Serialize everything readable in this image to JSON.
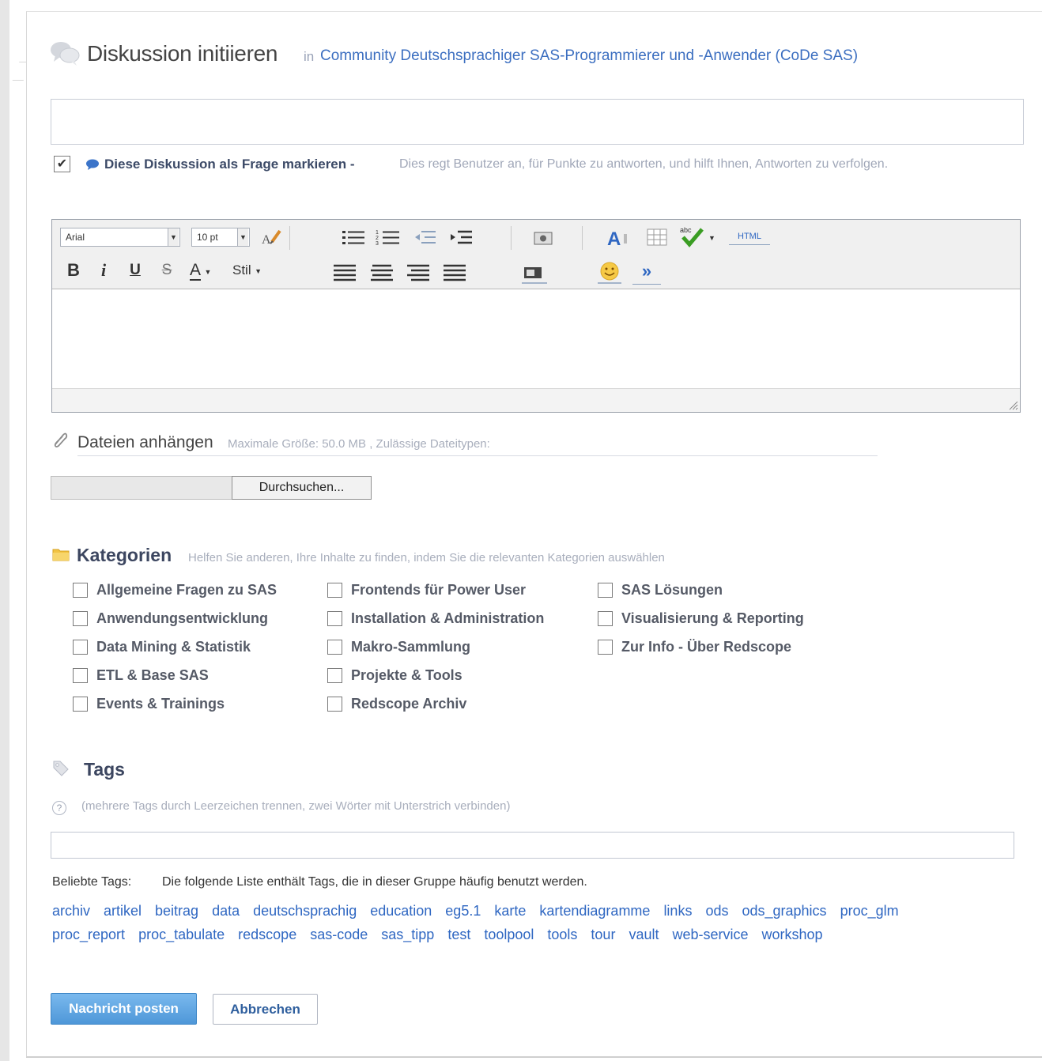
{
  "header": {
    "title": "Diskussion initiieren",
    "in_word": "in",
    "community_link": "Community Deutschsprachiger SAS-Programmierer und -Anwender (CoDe SAS)"
  },
  "subject": {
    "value": "",
    "placeholder": ""
  },
  "question": {
    "checked": true,
    "check_glyph": "✔",
    "label": "Diese Diskussion als Frage markieren -",
    "hint": "Dies regt Benutzer an, für Punkte zu antworten, und hilft Ihnen, Antworten zu verfolgen."
  },
  "editor": {
    "font": "Arial",
    "size": "10 pt",
    "bold": "B",
    "italic": "i",
    "underline": "U",
    "strike": "S",
    "font_color": "A",
    "style": "Stil",
    "html": "HTML",
    "abc": "abc",
    "more": "»"
  },
  "attach": {
    "title": "Dateien anhängen",
    "hint": "Maximale Größe: 50.0 MB , Zulässige Dateitypen:",
    "browse_label": "Durchsuchen..."
  },
  "categories": {
    "title": "Kategorien",
    "hint": "Helfen Sie anderen, Ihre Inhalte zu finden, indem Sie die relevanten Kategorien auswählen",
    "col1": [
      "Allgemeine Fragen zu SAS",
      "Anwendungsentwicklung",
      "Data Mining & Statistik",
      "ETL & Base SAS",
      "Events & Trainings"
    ],
    "col2": [
      "Frontends für Power User",
      "Installation & Administration",
      "Makro-Sammlung",
      "Projekte & Tools",
      "Redscope Archiv"
    ],
    "col3": [
      "SAS Lösungen",
      "Visualisierung & Reporting",
      "Zur Info - Über Redscope"
    ]
  },
  "tags": {
    "title": "Tags",
    "help_glyph": "?",
    "hint": "(mehrere Tags durch Leerzeichen trennen, zwei Wörter mit Unterstrich verbinden)",
    "input_value": "",
    "popular_label": "Beliebte Tags:",
    "popular_hint": "Die folgende Liste enthält Tags, die in dieser Gruppe häufig benutzt werden.",
    "row1": [
      "archiv",
      "artikel",
      "beitrag",
      "data",
      "deutschsprachig",
      "education",
      "eg5.1",
      "karte",
      "kartendiagramme",
      "links",
      "ods",
      "ods_graphics",
      "proc_glm"
    ],
    "row2": [
      "proc_report",
      "proc_tabulate",
      "redscope",
      "sas-code",
      "sas_tipp",
      "test",
      "toolpool",
      "tools",
      "tour",
      "vault",
      "web-service",
      "workshop"
    ]
  },
  "actions": {
    "post_label": "Nachricht posten",
    "cancel_label": "Abbrechen"
  },
  "colors": {
    "link": "#2f67c2",
    "primary_button": "#4e97d8",
    "heading": "#3c4660"
  },
  "icons": {
    "header": "speech-bubbles-icon",
    "question": "speech-bubble-icon",
    "attach": "paperclip-icon",
    "categories": "folder-icon",
    "tags": "tag-icon",
    "help": "help-circle-icon"
  }
}
